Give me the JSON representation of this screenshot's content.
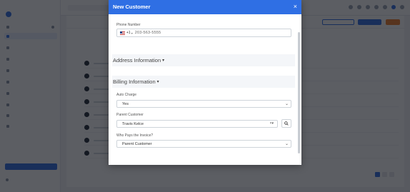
{
  "modal": {
    "title": "New Customer",
    "close_symbol": "×",
    "phone": {
      "label": "Phone Number",
      "country_flag": "us-flag-icon",
      "dial_code": "+1",
      "value": "203-563-5555"
    },
    "sections": {
      "address": {
        "title": "Address Information"
      },
      "billing": {
        "title": "Billing Information"
      }
    },
    "auto_charge": {
      "label": "Auto Charge",
      "value": "Yes"
    },
    "parent_customer": {
      "label": "Parent Customer",
      "value": "Travis Kelce",
      "clear_symbol": "×"
    },
    "who_pays": {
      "label": "Who Pays the Invoice?",
      "value": "Parent Customer"
    }
  },
  "colors": {
    "accent": "#2f6fe4",
    "header_text": "#ffffff",
    "overlay": "rgba(15,18,25,0.68)"
  },
  "icons": [
    "close-icon",
    "chevron-down-icon",
    "search-icon",
    "us-flag-icon"
  ]
}
